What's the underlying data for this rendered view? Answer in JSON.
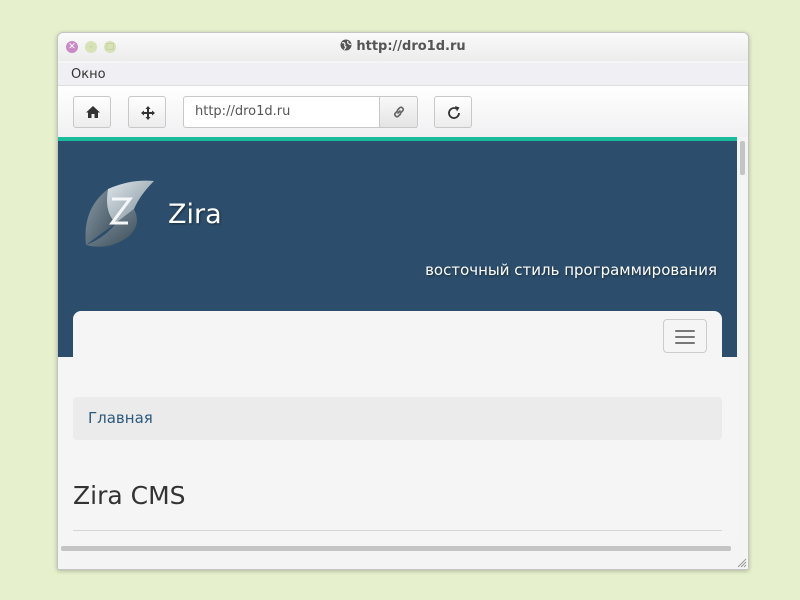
{
  "window": {
    "title": "http://dro1d.ru",
    "controls": [
      "close-icon",
      "minimize-icon",
      "maximize-icon"
    ]
  },
  "menubar": {
    "items": [
      {
        "label": "Окно"
      }
    ]
  },
  "toolbar": {
    "url_value": "http://dro1d.ru",
    "icons": [
      "home-icon",
      "move-icon",
      "link-icon",
      "reload-icon"
    ]
  },
  "site": {
    "name": "Zira",
    "tagline": "восточный стиль программирования",
    "breadcrumb": [
      "Главная"
    ],
    "heading": "Zira CMS",
    "colors": {
      "header": "#2c4e6c",
      "accent": "#1abc9c",
      "link": "#2c5a7c"
    }
  }
}
